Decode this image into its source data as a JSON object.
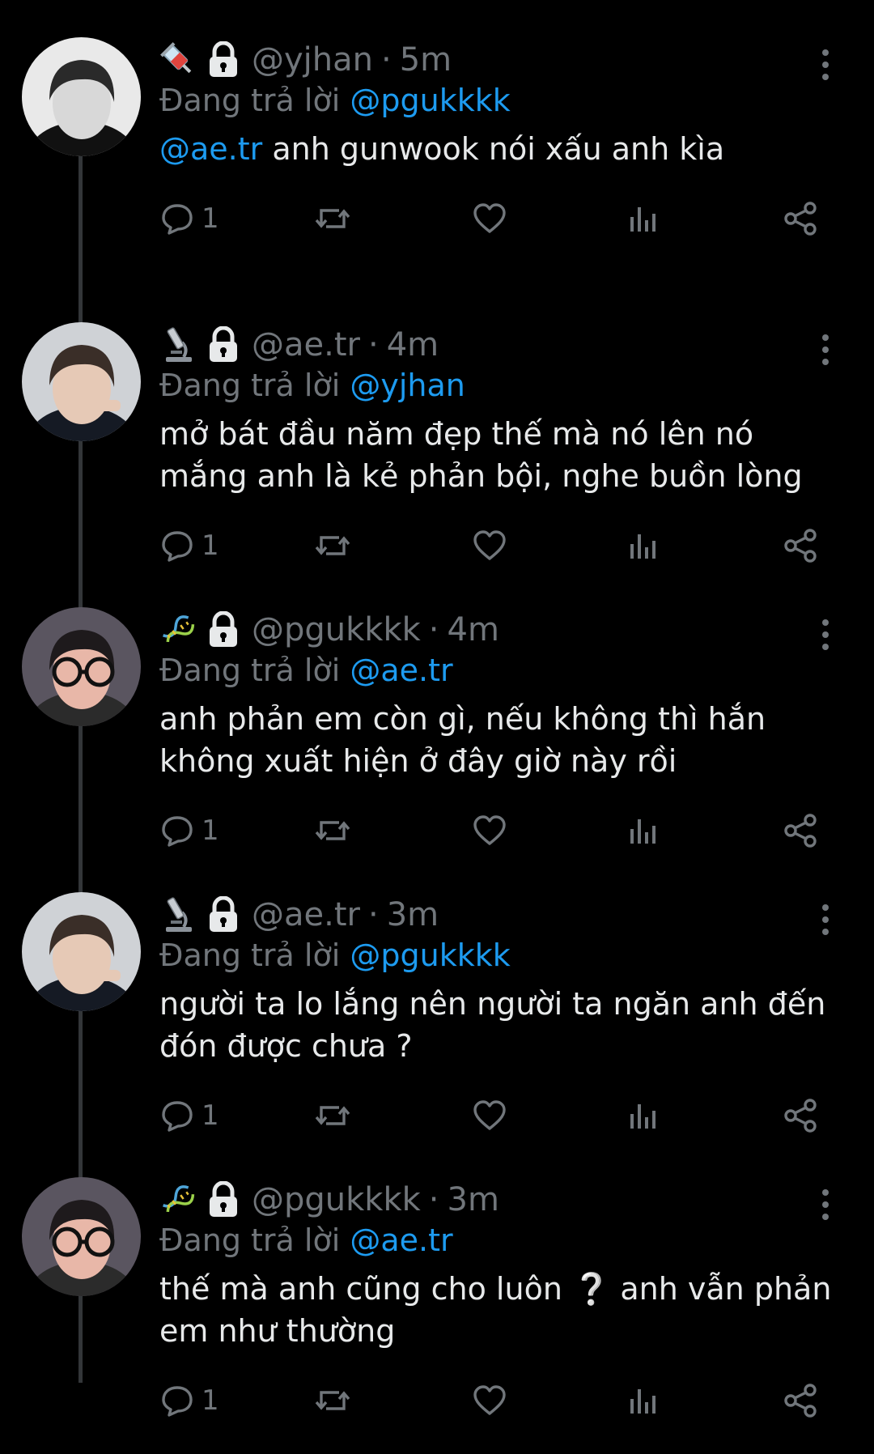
{
  "colors": {
    "background": "#000000",
    "text": "#e7e9ea",
    "muted": "#71767b",
    "link": "#1d9bf0",
    "thread_line": "#333639"
  },
  "replying_prefix": "Đang trả lời",
  "tweets": [
    {
      "emoji": "syringe-emoji",
      "handle": "@yjhan",
      "time": "5m",
      "replying_to": "@pgukkkk",
      "mention": "@ae.tr",
      "text": "anh gunwook nói xấu anh kìa",
      "replies": "1"
    },
    {
      "emoji": "microscope-emoji",
      "handle": "@ae.tr",
      "time": "4m",
      "replying_to": "@yjhan",
      "mention": "",
      "text": "mở bát đầu năm đẹp thế mà nó lên nó mắng anh là kẻ phản bội, nghe buồn lòng",
      "replies": "1"
    },
    {
      "emoji": "dna-emoji",
      "handle": "@pgukkkk",
      "time": "4m",
      "replying_to": "@ae.tr",
      "mention": "",
      "text": "anh phản em còn gì, nếu không thì hắn không xuất hiện ở đây giờ này rồi",
      "replies": "1"
    },
    {
      "emoji": "microscope-emoji",
      "handle": "@ae.tr",
      "time": "3m",
      "replying_to": "@pgukkkk",
      "mention": "",
      "text": "người ta lo lắng nên người ta ngăn anh đến đón được chưa ?",
      "replies": "1"
    },
    {
      "emoji": "dna-emoji",
      "handle": "@pgukkkk",
      "time": "3m",
      "replying_to": "@ae.tr",
      "mention": "",
      "text": "thế mà anh cũng cho luôn ❔ anh vẫn phản em như thường",
      "replies": "1"
    }
  ]
}
